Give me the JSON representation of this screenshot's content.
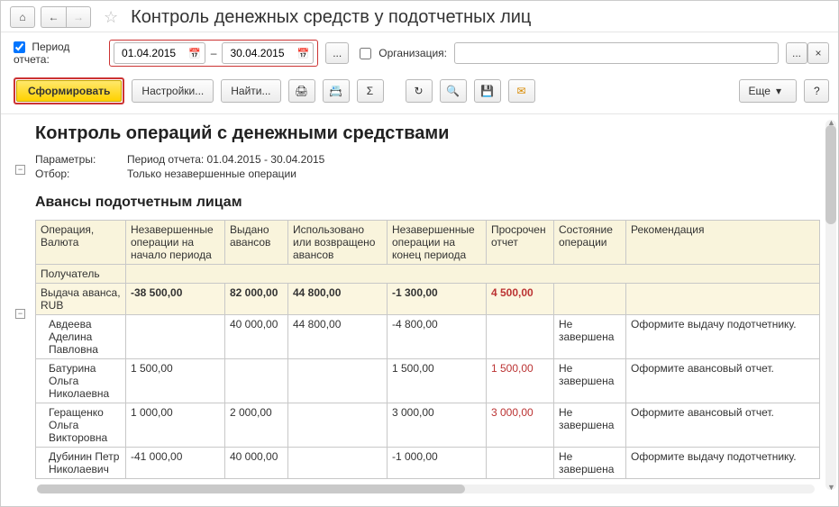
{
  "page": {
    "title": "Контроль денежных средств у подотчетных лиц"
  },
  "filter": {
    "period_label": "Период отчета:",
    "date_from": "01.04.2015",
    "date_to": "30.04.2015",
    "dash": "–",
    "ellipsis": "...",
    "org_label": "Организация:",
    "clear": "×"
  },
  "toolbar": {
    "generate": "Сформировать",
    "settings": "Настройки...",
    "find": "Найти...",
    "more": "Еще",
    "help": "?"
  },
  "icons": {
    "home": "⌂",
    "back": "←",
    "fwd": "→",
    "star": "☆",
    "cal": "📅",
    "print": "🖨",
    "calc": "📇",
    "sigma": "Σ",
    "refresh": "↻",
    "zoom": "🔍",
    "save": "💾",
    "mail": "✉",
    "caret": "▾",
    "collapse": "−"
  },
  "report": {
    "title": "Контроль операций с денежными средствами",
    "params_label": "Параметры:",
    "params_value": "Период отчета: 01.04.2015 - 30.04.2015",
    "filter_label": "Отбор:",
    "filter_value": "Только незавершенные операции",
    "section_title": "Авансы подотчетным лицам",
    "columns": {
      "c1a": "Операция,",
      "c1b": "Валюта",
      "c1c": "Получатель",
      "c2": "Незавершенные операции на начало периода",
      "c3": "Выдано авансов",
      "c4": "Использовано или возвращено авансов",
      "c5": "Незавершенные операции на конец периода",
      "c6": "Просрочен отчет",
      "c7": "Состояние операции",
      "c8": "Рекомендация"
    },
    "totals": {
      "label": "Выдача аванса, RUB",
      "c2": "-38 500,00",
      "c3": "82 000,00",
      "c4": "44 800,00",
      "c5": "-1 300,00",
      "c6": "4 500,00"
    },
    "rows": [
      {
        "name": "Авдеева Аделина Павловна",
        "c2": "",
        "c3": "40 000,00",
        "c4": "44 800,00",
        "c5": "-4 800,00",
        "c6": "",
        "state": "Не завершена",
        "rec": "Оформите выдачу подотчетнику."
      },
      {
        "name": "Батурина Ольга Николаевна",
        "c2": "1 500,00",
        "c3": "",
        "c4": "",
        "c5": "1 500,00",
        "c6": "1 500,00",
        "state": "Не завершена",
        "rec": "Оформите авансовый отчет."
      },
      {
        "name": "Геращенко Ольга Викторовна",
        "c2": "1 000,00",
        "c3": "2 000,00",
        "c4": "",
        "c5": "3 000,00",
        "c6": "3 000,00",
        "state": "Не завершена",
        "rec": "Оформите авансовый отчет."
      },
      {
        "name": "Дубинин Петр Николаевич",
        "c2": "-41 000,00",
        "c3": "40 000,00",
        "c4": "",
        "c5": "-1 000,00",
        "c6": "",
        "state": "Не завершена",
        "rec": "Оформите выдачу подотчетнику."
      }
    ]
  }
}
